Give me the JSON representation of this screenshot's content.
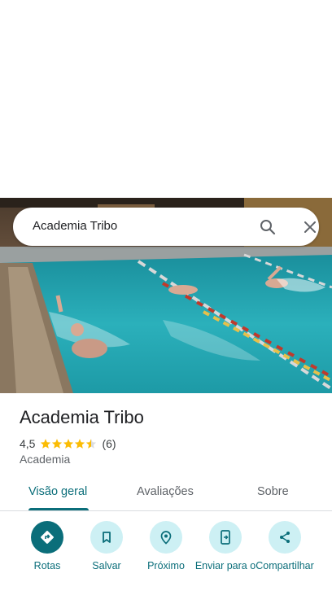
{
  "search": {
    "query": "Academia Tribo"
  },
  "place": {
    "title": "Academia Tribo",
    "rating": "4,5",
    "rating_stars": 4.5,
    "review_count": "(6)",
    "category": "Academia"
  },
  "tabs": [
    {
      "label": "Visão geral",
      "active": true
    },
    {
      "label": "Avaliações",
      "active": false
    },
    {
      "label": "Sobre",
      "active": false
    }
  ],
  "actions": [
    {
      "label": "Rotas",
      "icon": "directions-icon"
    },
    {
      "label": "Salvar",
      "icon": "bookmark-icon"
    },
    {
      "label": "Próximo",
      "icon": "nearby-icon"
    },
    {
      "label": "Enviar para o",
      "icon": "send-to-phone-icon"
    },
    {
      "label": "Compartilhar",
      "icon": "share-icon"
    }
  ],
  "colors": {
    "accent": "#0b6e7a",
    "action_bg": "#cdf0f4",
    "star": "#fbbc04",
    "pool_water": "#2aa8b4"
  }
}
